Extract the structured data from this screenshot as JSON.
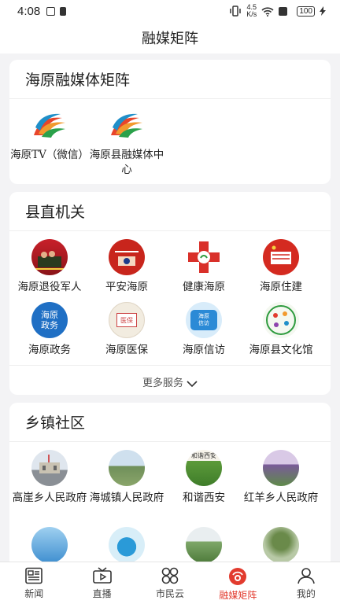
{
  "status": {
    "time": "4:08",
    "net_speed": "4.5\nK/s",
    "battery": "100"
  },
  "header": {
    "title": "融媒矩阵"
  },
  "section1": {
    "title": "海原融媒体矩阵",
    "items": [
      {
        "label": "海原TV（微信）"
      },
      {
        "label": "海原县融媒体中心"
      }
    ]
  },
  "section2": {
    "title": "县直机关",
    "items": [
      {
        "label": "海原退役军人"
      },
      {
        "label": "平安海原"
      },
      {
        "label": "健康海原"
      },
      {
        "label": "海原住建"
      },
      {
        "label": "海原政务",
        "icon_text": "海原政务"
      },
      {
        "label": "海原医保",
        "icon_text": "医保"
      },
      {
        "label": "海原信访",
        "icon_text": "海原信访"
      },
      {
        "label": "海原县文化馆"
      }
    ],
    "more_label": "更多服务"
  },
  "section3": {
    "title": "乡镇社区",
    "items": [
      {
        "label": "高崖乡人民政府"
      },
      {
        "label": "海城镇人民政府"
      },
      {
        "label": "和谐西安",
        "icon_text": "和谐西安"
      },
      {
        "label": "红羊乡人民政府"
      }
    ]
  },
  "tabs": [
    {
      "label": "新闻",
      "icon": "news-icon"
    },
    {
      "label": "直播",
      "icon": "tv-icon"
    },
    {
      "label": "市民云",
      "icon": "grid-icon"
    },
    {
      "label": "融媒矩阵",
      "icon": "play-circle-icon",
      "active": true
    },
    {
      "label": "我的",
      "icon": "user-icon"
    }
  ],
  "colors": {
    "accent": "#e23b2e",
    "background": "#f3f3f5"
  }
}
